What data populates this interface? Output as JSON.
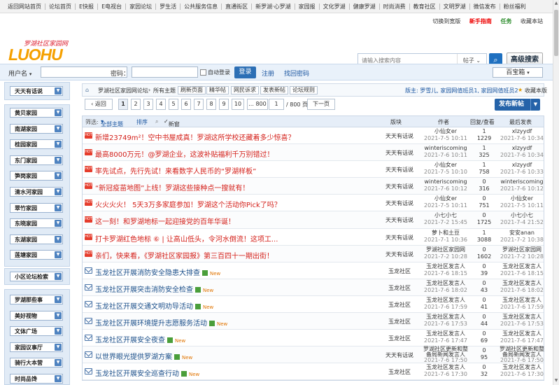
{
  "topnav": [
    "返回网站首页",
    "论坛首页",
    "E快报",
    "E电视台",
    "家园论坛",
    "罗生活",
    "公共服务信息",
    "直通街区",
    "新罗湖·心罗湖",
    "家园报",
    "文化罗湖",
    "健康罗湖",
    "时尚消费",
    "教育社区",
    "文明罗湖",
    "微信发布",
    "粉丝福利"
  ],
  "toplinks": {
    "switch": "切换到宽版",
    "hot": "新手指南",
    "task": "任务",
    "fav": "收藏本站"
  },
  "logo": {
    "tagline": "罗湖社区家园网",
    "brand": "LUOHU",
    ".com": ".com"
  },
  "search": {
    "placeholder": "请输入搜索内容",
    "scope": "帖子",
    "advanced": "高级搜索"
  },
  "login": {
    "user_label": "用户名",
    "password_label": "密码：",
    "auto_label": "自动登录",
    "login_btn": "登录",
    "register": "注册",
    "forgot": "找回密码",
    "baibox": "百宝箱"
  },
  "sidebar": {
    "top": "天天有话说",
    "groups": [
      "黄贝家园",
      "南湖家园",
      "桂园家园",
      "东门家园",
      "笋岗家园",
      "清水河家园",
      "翠竹家园",
      "东晓家园",
      "东湖家园",
      "莲塘家园"
    ],
    "mid": "小区论坛检索",
    "bottom": [
      "罗湖那些事",
      "美好视物",
      "文体广场",
      "家园议事厅",
      "骑行大本营",
      "时尚品馋"
    ]
  },
  "crumb": {
    "home": "罗湖社区家园网论坛",
    "sep": "›",
    "all": "所有主题",
    "b1": "刷新页面",
    "b2": "精华帖",
    "b3": "网民诉求",
    "b4": "发表新帖",
    "b5": "论坛规则",
    "mods": "版主: 罗雪儿, 家园网值班员1, 家园网值班员2",
    "fav": "收藏本版"
  },
  "pager": {
    "back": "返回",
    "pages": [
      "1",
      "2",
      "3",
      "4",
      "5",
      "6",
      "7",
      "8",
      "9",
      "10",
      "... 800"
    ],
    "current": "1",
    "total": "/ 800 页",
    "next": "下一页",
    "post": "发布新帖"
  },
  "thead": {
    "filter": "筛选:",
    "all": "全部主题",
    "sort": "排序",
    "newwin": "新窗",
    "forum": "版块",
    "author": "作者",
    "stats": "回复/查看",
    "last": "最后发表"
  },
  "rows": [
    {
      "icon": "hot",
      "title": "新增23749m²！空中书屋成真！罗湖这所学校还藏着多少惊喜？",
      "color": "red",
      "forum": "天天有话说",
      "author": "小仙女er",
      "adate": "2021-7-5 10:11",
      "reply": "1",
      "view": "1229",
      "last": "xlzyydf",
      "ldate": "2021-7-6 10:34"
    },
    {
      "icon": "hot",
      "title": "最高8000万元！@罗湖企业，这波补贴福利千万别错过！",
      "color": "red",
      "forum": "天天有话说",
      "author": "winteriscoming",
      "adate": "2021-7-6 10:11",
      "reply": "1",
      "view": "325",
      "last": "xlzyydf",
      "ldate": "2021-7-6 10:34"
    },
    {
      "icon": "hot",
      "title": "率先试点，先行先试！来看数字人民币的“罗湖样板”",
      "color": "red",
      "forum": "天天有话说",
      "author": "小仙女er",
      "adate": "2021-7-5 10:10",
      "reply": "1",
      "view": "758",
      "last": "xlzyydf",
      "ldate": "2021-7-6 10:33"
    },
    {
      "icon": "hot",
      "title": "“新冠疫苗地图”上线！罗湖这些接种点一搜就有！",
      "color": "red",
      "forum": "天天有话说",
      "author": "winteriscoming",
      "adate": "2021-7-6 10:12",
      "reply": "0",
      "view": "316",
      "last": "winteriscoming",
      "ldate": "2021-7-6 10:12"
    },
    {
      "icon": "hot",
      "title": "火火火火！ 5天3万多家庭参加！罗湖这个活动你Pick了吗？",
      "color": "red",
      "forum": "天天有话说",
      "author": "小仙女er",
      "adate": "2021-7-5 10:11",
      "reply": "0",
      "view": "751",
      "last": "小仙女er",
      "ldate": "2021-7-5 10:11"
    },
    {
      "icon": "hot",
      "title": "这一刻！和罗湖地标一起迎接党的百年华诞！",
      "color": "red",
      "forum": "天天有话说",
      "author": "小七小七",
      "adate": "2021-7-2 15:45",
      "reply": "0",
      "view": "1725",
      "last": "小七小七",
      "ldate": "2021-7-4 21:52"
    },
    {
      "icon": "hot",
      "title": "打卡罗湖红色地标 ⑥ | 让高山低头，令河水倒流！这项工...",
      "color": "red",
      "forum": "天天有话说",
      "author": "萝卜和土豆",
      "adate": "2021-7-1 10:36",
      "reply": "1",
      "view": "3088",
      "last": "安安anan",
      "ldate": "2021-7-2 10:38"
    },
    {
      "icon": "hot",
      "title": "亲们，快来看，《罗湖社区家园报》第三百四十一期出街！",
      "color": "red",
      "forum": "天天有话说",
      "author": "罗湖社区家园网",
      "adate": "2021-7-2 10:28",
      "reply": "0",
      "view": "1602",
      "last": "罗湖社区家园网",
      "ldate": "2021-7-2 10:28"
    },
    {
      "icon": "mail",
      "title": "玉龙社区开展消防安全隐患大排查",
      "color": "blue",
      "forum": "玉龙社区",
      "author": "玉龙社区发言人",
      "adate": "2021-7-6 18:15",
      "reply": "0",
      "view": "39",
      "last": "玉龙社区发言人",
      "ldate": "2021-7-6 18:15",
      "isnew": true
    },
    {
      "icon": "mail",
      "title": "玉龙社区开展突击消防安全检查",
      "color": "blue",
      "forum": "玉龙社区",
      "author": "玉龙社区发言人",
      "adate": "2021-7-6 18:02",
      "reply": "0",
      "view": "43",
      "last": "玉龙社区发言人",
      "ldate": "2021-7-6 18:02",
      "isnew": true
    },
    {
      "icon": "mail",
      "title": "玉龙社区开展交通文明劝导活动",
      "color": "blue",
      "forum": "玉龙社区",
      "author": "玉龙社区发言人",
      "adate": "2021-7-6 17:59",
      "reply": "0",
      "view": "41",
      "last": "玉龙社区发言人",
      "ldate": "2021-7-6 17:59",
      "isnew": true
    },
    {
      "icon": "mail",
      "title": "玉龙社区开展环境提升志愿服务活动",
      "color": "blue",
      "forum": "玉龙社区",
      "author": "玉龙社区发言人",
      "adate": "2021-7-6 17:53",
      "reply": "0",
      "view": "44",
      "last": "玉龙社区发言人",
      "ldate": "2021-7-6 17:53",
      "isnew": true
    },
    {
      "icon": "mail",
      "title": "玉龙社区开展安全夜查",
      "color": "blue",
      "forum": "玉龙社区",
      "author": "玉龙社区发言人",
      "adate": "2021-7-6 17:47",
      "reply": "0",
      "view": "69",
      "last": "玉龙社区发言人",
      "ldate": "2021-7-6 17:47",
      "isnew": true
    },
    {
      "icon": "mail",
      "title": "以世界眼光提供罗湖方案",
      "color": "blue",
      "forum": "天天有话说",
      "author": "罗湖社区更新和整备局新闻发言人",
      "adate": "2021-7-6 17:50",
      "reply": "0",
      "view": "95",
      "last": "罗湖社区更新和整备局新闻发言人",
      "ldate": "2021-7-6 17:50",
      "isnew": true,
      "multi": true
    },
    {
      "icon": "mail",
      "title": "玉龙社区开展安全巡查行动",
      "color": "blue",
      "forum": "玉龙社区",
      "author": "玉龙社区发言人",
      "adate": "2021-7-6 17:30",
      "reply": "0",
      "view": "32",
      "last": "玉龙社区发言人",
      "ldate": "2021-7-6 17:30",
      "isnew": true
    }
  ],
  "new_label": "New"
}
